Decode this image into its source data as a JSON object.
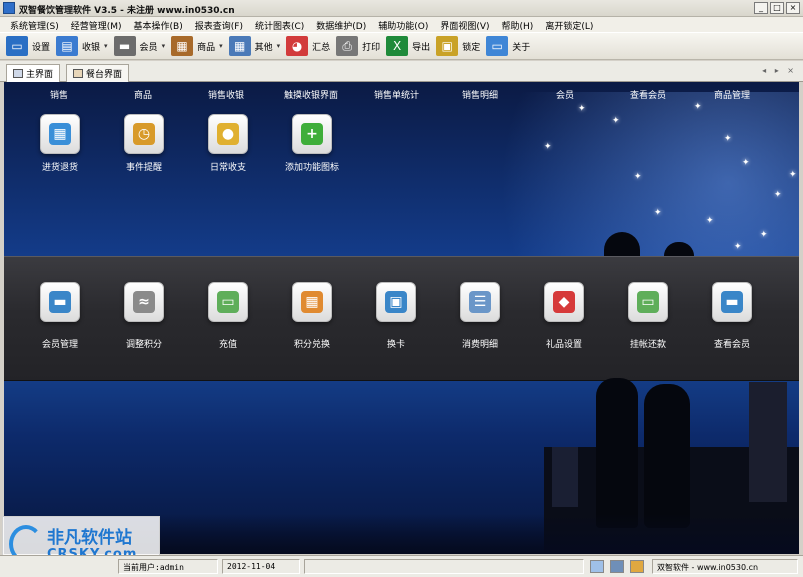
{
  "window": {
    "title": "双智餐饮管理软件 V3.5  - 未注册 www.in0530.cn",
    "min": "_",
    "max": "□",
    "close": "×"
  },
  "menu": [
    "系统管理(S)",
    "经营管理(M)",
    "基本操作(B)",
    "报表查询(F)",
    "统计图表(C)",
    "数据维护(D)",
    "辅助功能(O)",
    "界面视图(V)",
    "帮助(H)",
    "离开锁定(L)"
  ],
  "toolbar": [
    {
      "label": "设置",
      "icon": "monitor-icon",
      "color": "#2a6fc4",
      "arrow": false
    },
    {
      "label": "收银",
      "icon": "cashier-icon",
      "color": "#3b7bd0",
      "arrow": true
    },
    {
      "label": "会员",
      "icon": "member-card-icon",
      "color": "#6c6c6c",
      "arrow": true
    },
    {
      "label": "商品",
      "icon": "goods-box-icon",
      "color": "#a86a2a",
      "arrow": true
    },
    {
      "label": "其他",
      "icon": "grid-icon",
      "color": "#4b7ab8",
      "arrow": true
    },
    {
      "label": "汇总",
      "icon": "pie-chart-icon",
      "color": "#d23b3b",
      "arrow": false
    },
    {
      "label": "打印",
      "icon": "printer-icon",
      "color": "#777777",
      "arrow": false
    },
    {
      "label": "导出",
      "icon": "excel-icon",
      "color": "#1f8a3a",
      "arrow": false
    },
    {
      "label": "锁定",
      "icon": "lock-icon",
      "color": "#c9a227",
      "arrow": false
    },
    {
      "label": "关于",
      "icon": "computer-icon",
      "color": "#3f86d6",
      "arrow": false
    }
  ],
  "tabs": [
    {
      "label": "主界面",
      "active": true
    },
    {
      "label": "餐台界面",
      "active": false
    }
  ],
  "tab_nav": "◂ ▸ ×",
  "top_labels": [
    "销售",
    "商品",
    "销售收银",
    "触摸收银界面",
    "销售单统计",
    "销售明细",
    "会员",
    "查看会员",
    "商品管理"
  ],
  "row1": [
    {
      "label": "进货退货",
      "icon": "stock-return-icon",
      "color": "#3a8fd8"
    },
    {
      "label": "事件提醒",
      "icon": "clock-icon",
      "color": "#d89a2a"
    },
    {
      "label": "日常收支",
      "icon": "coins-icon",
      "color": "#e0b030"
    },
    {
      "label": "添加功能图标",
      "icon": "plus-icon",
      "color": "#3fae3a"
    }
  ],
  "row2": [
    {
      "label": "会员管理",
      "icon": "member-card-icon",
      "color": "#3a86c8"
    },
    {
      "label": "调整积分",
      "icon": "chart-adjust-icon",
      "color": "#8a8a8a"
    },
    {
      "label": "充值",
      "icon": "recharge-card-icon",
      "color": "#5fae5a"
    },
    {
      "label": "积分兑换",
      "icon": "points-exchange-icon",
      "color": "#e08a30"
    },
    {
      "label": "换卡",
      "icon": "card-swap-icon",
      "color": "#3a86c8"
    },
    {
      "label": "消费明细",
      "icon": "detail-list-icon",
      "color": "#6a96c8"
    },
    {
      "label": "礼品设置",
      "icon": "gem-icon",
      "color": "#d63a3a"
    },
    {
      "label": "挂帐还款",
      "icon": "repay-card-icon",
      "color": "#5fae5a"
    },
    {
      "label": "查看会员",
      "icon": "view-member-icon",
      "color": "#3a86c8"
    }
  ],
  "watermark": {
    "cn": "非凡软件站",
    "en": "CRSKY.com"
  },
  "status": {
    "user_prefix": "当前用户:",
    "user": "admin",
    "date": "2012-11-04",
    "company": "双智软件 - www.in0530.cn"
  }
}
